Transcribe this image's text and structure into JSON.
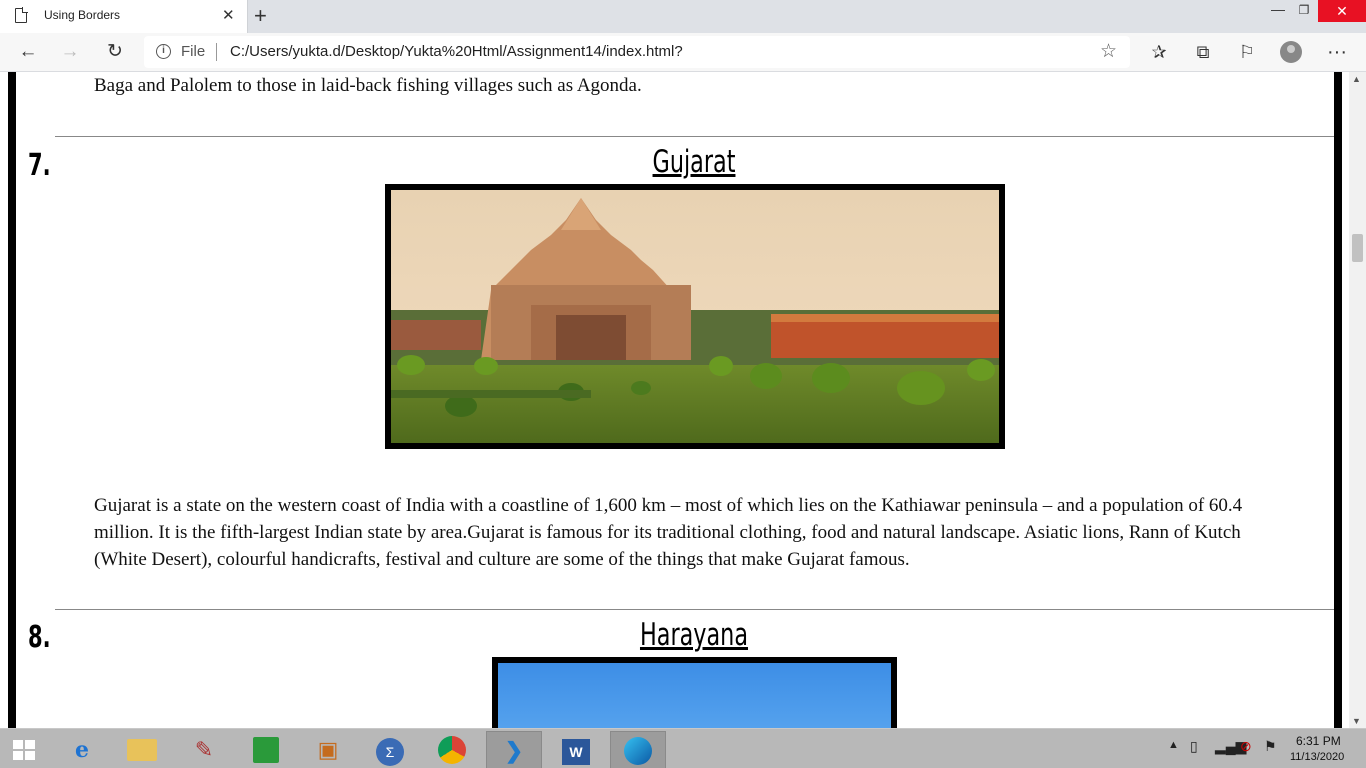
{
  "browser": {
    "tab_title": "Using Borders",
    "tab_close": "✕",
    "new_tab": "+",
    "file_label": "File",
    "url": "C:/Users/yukta.d/Desktop/Yukta%20Html/Assignment14/index.html?"
  },
  "page": {
    "prev_text": "Baga and Palolem to those in laid-back fishing villages such as Agonda.",
    "sections": [
      {
        "number": "7.",
        "title": "Gujarat",
        "image": "gujarat-temple-photo",
        "text": "Gujarat is a state on the western coast of India with a coastline of 1,600 km – most of which lies on the Kathiawar peninsula – and a population of 60.4 million. It is the fifth-largest Indian state by area.Gujarat is famous for its traditional clothing, food and natural landscape. Asiatic lions, Rann of Kutch (White Desert), colourful handicrafts, festival and culture are some of the things that make Gujarat famous."
      },
      {
        "number": "8.",
        "title": "Harayana",
        "image": "haryana-sky-photo"
      }
    ]
  },
  "taskbar": {
    "time": "6:31 PM",
    "date": "11/13/2020",
    "apps": [
      "internet-explorer-icon",
      "file-explorer-icon",
      "media-icon",
      "store-icon",
      "paint-icon",
      "math-input-icon",
      "chrome-icon",
      "vscode-icon",
      "word-icon",
      "edge-icon"
    ]
  },
  "colors": {
    "close_red": "#e81123",
    "frame_black": "#000000"
  }
}
